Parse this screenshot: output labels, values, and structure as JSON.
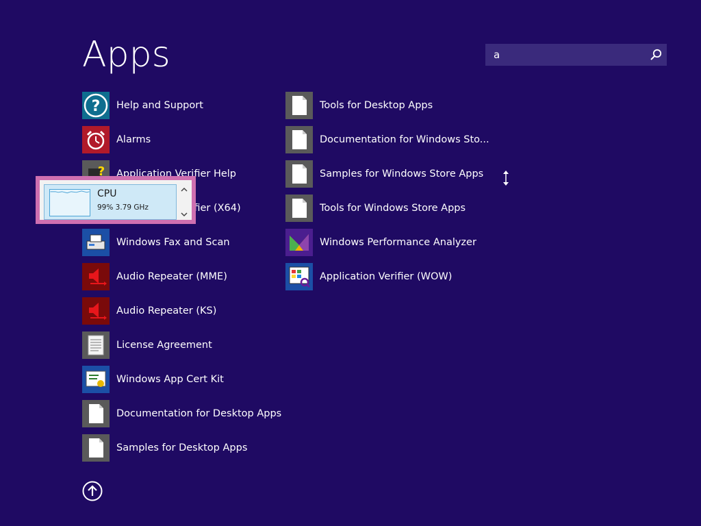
{
  "header": {
    "title": "Apps"
  },
  "search": {
    "value": "a",
    "icon": "search-icon"
  },
  "apps_left": [
    {
      "label": "Help and Support",
      "icon": "help-icon"
    },
    {
      "label": "Alarms",
      "icon": "alarm-clock-icon"
    },
    {
      "label": "Application Verifier Help",
      "icon": "help-document-icon"
    },
    {
      "label": "Application Verifier (X64)",
      "icon": "app-verifier-icon"
    },
    {
      "label": "Windows Fax and Scan",
      "icon": "fax-scanner-icon"
    },
    {
      "label": "Audio Repeater (MME)",
      "icon": "speaker-icon"
    },
    {
      "label": "Audio Repeater (KS)",
      "icon": "speaker-icon"
    },
    {
      "label": "License Agreement",
      "icon": "document-lines-icon"
    },
    {
      "label": "Windows App Cert Kit",
      "icon": "certificate-icon"
    },
    {
      "label": "Documentation for Desktop Apps",
      "icon": "document-icon"
    },
    {
      "label": "Samples for Desktop Apps",
      "icon": "document-icon"
    }
  ],
  "apps_right": [
    {
      "label": "Tools for Desktop Apps",
      "icon": "document-icon"
    },
    {
      "label": "Documentation for Windows Sto...",
      "icon": "document-icon"
    },
    {
      "label": "Samples for Windows Store Apps",
      "icon": "document-icon"
    },
    {
      "label": "Tools for Windows Store Apps",
      "icon": "document-icon"
    },
    {
      "label": "Windows Performance Analyzer",
      "icon": "performance-analyzer-icon"
    },
    {
      "label": "Application Verifier (WOW)",
      "icon": "app-verifier-icon"
    }
  ],
  "cpu_popup": {
    "title": "CPU",
    "usage": "99%",
    "speed": "3.79 GHz",
    "subtitle": "99%  3.79 GHz"
  },
  "colors": {
    "background": "#1f0a63",
    "search_box": "#3a2a7c",
    "popup_border": "#cf6fb0",
    "popup_select": "#cfe9f7"
  }
}
